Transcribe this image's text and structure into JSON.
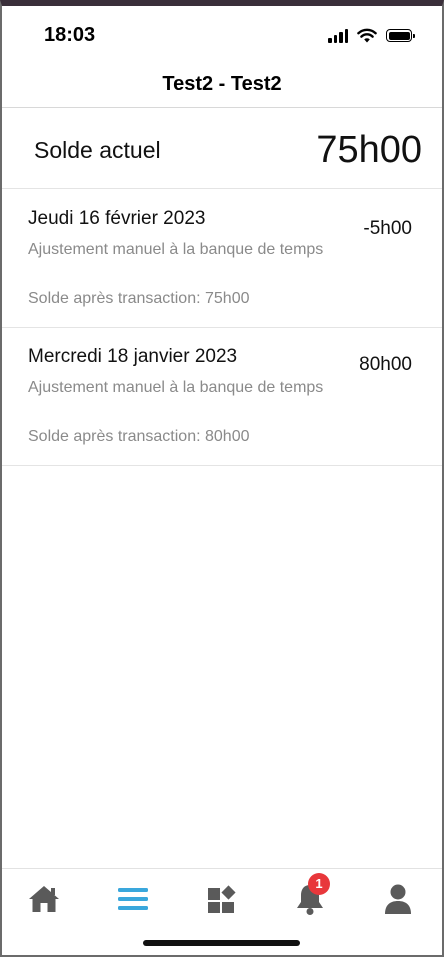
{
  "status": {
    "time": "18:03"
  },
  "header": {
    "title": "Test2 - Test2"
  },
  "balance": {
    "label": "Solde actuel",
    "value": "75h00"
  },
  "transactions": [
    {
      "date": "Jeudi 16 février 2023",
      "amount": "-5h00",
      "description": "Ajustement manuel à la banque de temps",
      "balance_after": "Solde après transaction: 75h00"
    },
    {
      "date": "Mercredi 18 janvier 2023",
      "amount": "80h00",
      "description": "Ajustement manuel à la banque de temps",
      "balance_after": "Solde après transaction: 80h00"
    }
  ],
  "tabbar": {
    "items": [
      {
        "icon": "home-icon",
        "active": false
      },
      {
        "icon": "list-icon",
        "active": true
      },
      {
        "icon": "apps-icon",
        "active": false
      },
      {
        "icon": "bell-icon",
        "active": false,
        "badge": "1"
      },
      {
        "icon": "user-icon",
        "active": false
      }
    ],
    "active_color": "#3aa7dc",
    "inactive_color": "#5a5a5a",
    "badge_color": "#e8373b"
  }
}
